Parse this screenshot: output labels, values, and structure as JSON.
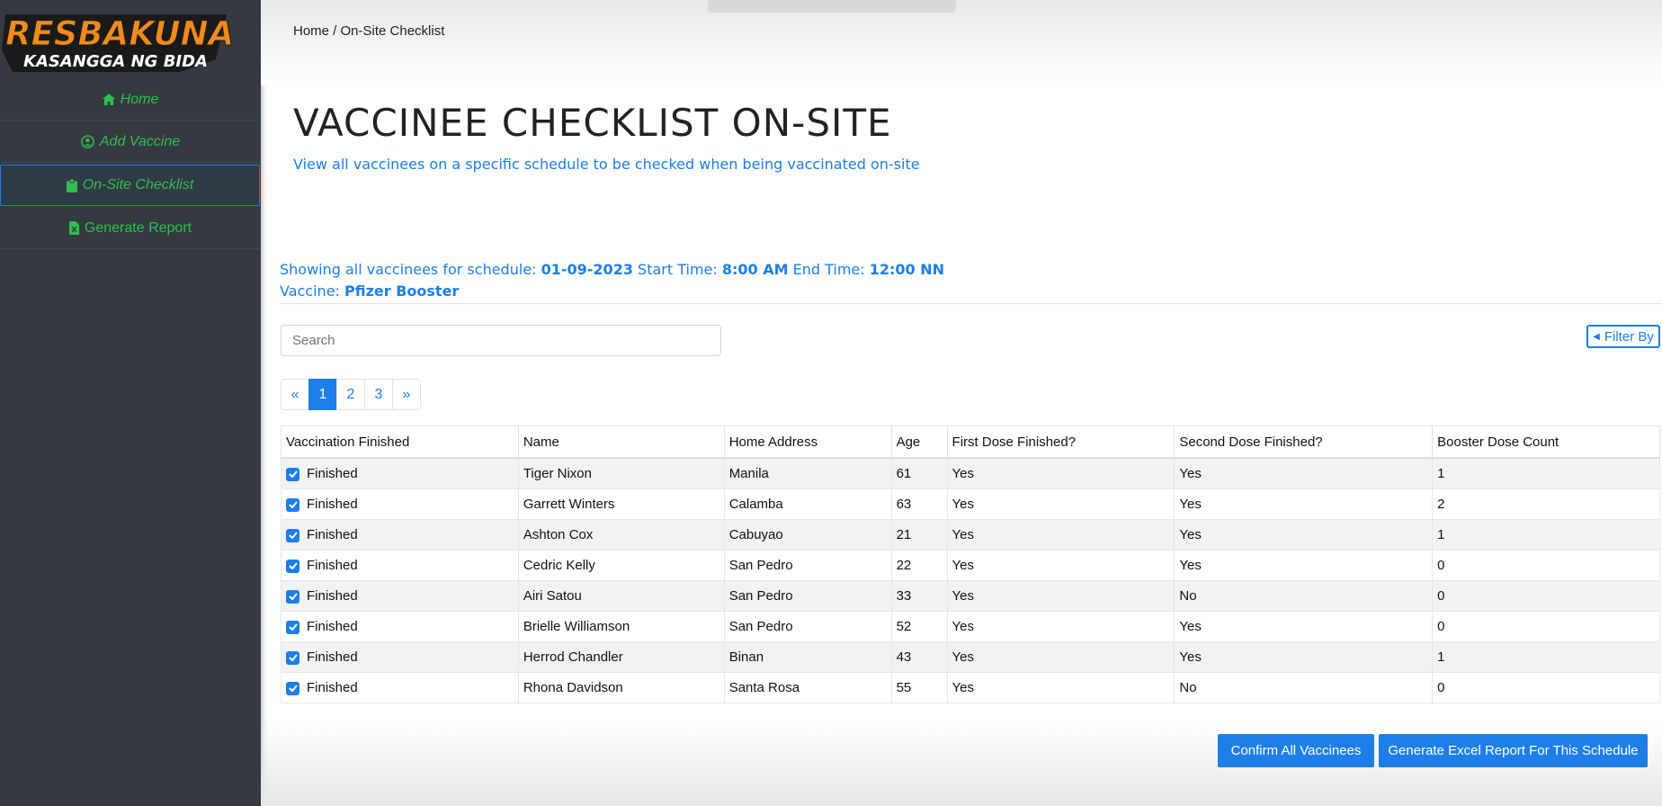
{
  "brand": {
    "logo_top": "RESBAKUNA",
    "logo_bottom": "KASANGGA NG BIDA",
    "colors": {
      "orange": "#f08a1c",
      "blue": "#1aa0e6",
      "dark": "#1a1a1a"
    }
  },
  "sidebar": {
    "items": [
      {
        "label": "Home",
        "icon": "home-icon",
        "active": false
      },
      {
        "label": "Add Vaccine",
        "icon": "user-circle-icon",
        "active": false
      },
      {
        "label": "On-Site Checklist",
        "icon": "clipboard-icon",
        "active": true
      },
      {
        "label": "Generate Report",
        "icon": "excel-file-icon",
        "active": false
      }
    ]
  },
  "breadcrumb": "Home / On-Site Checklist",
  "page": {
    "title": "VACCINEE CHECKLIST ON-SITE",
    "subtitle": "View all vaccinees on a specific schedule to be checked when being vaccinated on-site"
  },
  "schedule": {
    "prefix": "Showing all vaccinees for schedule: ",
    "date": "01-09-2023",
    "start_label": " Start Time: ",
    "start_time": "8:00 AM",
    "end_label": " End Time: ",
    "end_time": "12:00 NN",
    "vaccine_label": "Vaccine: ",
    "vaccine": "Pfizer Booster"
  },
  "search": {
    "placeholder": "Search",
    "value": ""
  },
  "filter": {
    "label": "Filter By"
  },
  "pagination": {
    "prev": "«",
    "pages": [
      "1",
      "2",
      "3"
    ],
    "next": "»",
    "current": "1"
  },
  "table": {
    "columns": [
      "Vaccination Finished",
      "Name",
      "Home Address",
      "Age",
      "First Dose Finished?",
      "Second Dose Finished?",
      "Booster Dose Count"
    ],
    "rows": [
      {
        "status": "Finished",
        "checked": true,
        "name": "Tiger Nixon",
        "address": "Manila",
        "age": "61",
        "first": "Yes",
        "second": "Yes",
        "booster": "1"
      },
      {
        "status": "Finished",
        "checked": true,
        "name": "Garrett Winters",
        "address": "Calamba",
        "age": "63",
        "first": "Yes",
        "second": "Yes",
        "booster": "2"
      },
      {
        "status": "Finished",
        "checked": true,
        "name": "Ashton Cox",
        "address": "Cabuyao",
        "age": "21",
        "first": "Yes",
        "second": "Yes",
        "booster": "1"
      },
      {
        "status": "Finished",
        "checked": true,
        "name": "Cedric Kelly",
        "address": "San Pedro",
        "age": "22",
        "first": "Yes",
        "second": "Yes",
        "booster": "0"
      },
      {
        "status": "Finished",
        "checked": true,
        "name": "Airi Satou",
        "address": "San Pedro",
        "age": "33",
        "first": "Yes",
        "second": "No",
        "booster": "0"
      },
      {
        "status": "Finished",
        "checked": true,
        "name": "Brielle Williamson",
        "address": "San Pedro",
        "age": "52",
        "first": "Yes",
        "second": "Yes",
        "booster": "0"
      },
      {
        "status": "Finished",
        "checked": true,
        "name": "Herrod Chandler",
        "address": "Binan",
        "age": "43",
        "first": "Yes",
        "second": "Yes",
        "booster": "1"
      },
      {
        "status": "Finished",
        "checked": true,
        "name": "Rhona Davidson",
        "address": "Santa Rosa",
        "age": "55",
        "first": "Yes",
        "second": "No",
        "booster": "0"
      }
    ]
  },
  "actions": {
    "confirm_label": "Confirm All Vaccinees",
    "excel_label": "Generate Excel Report For This Schedule"
  },
  "theme": {
    "accent": "#1d7ee8",
    "sidebar_bg": "#343a40",
    "nav_green": "#2fbf4f"
  }
}
